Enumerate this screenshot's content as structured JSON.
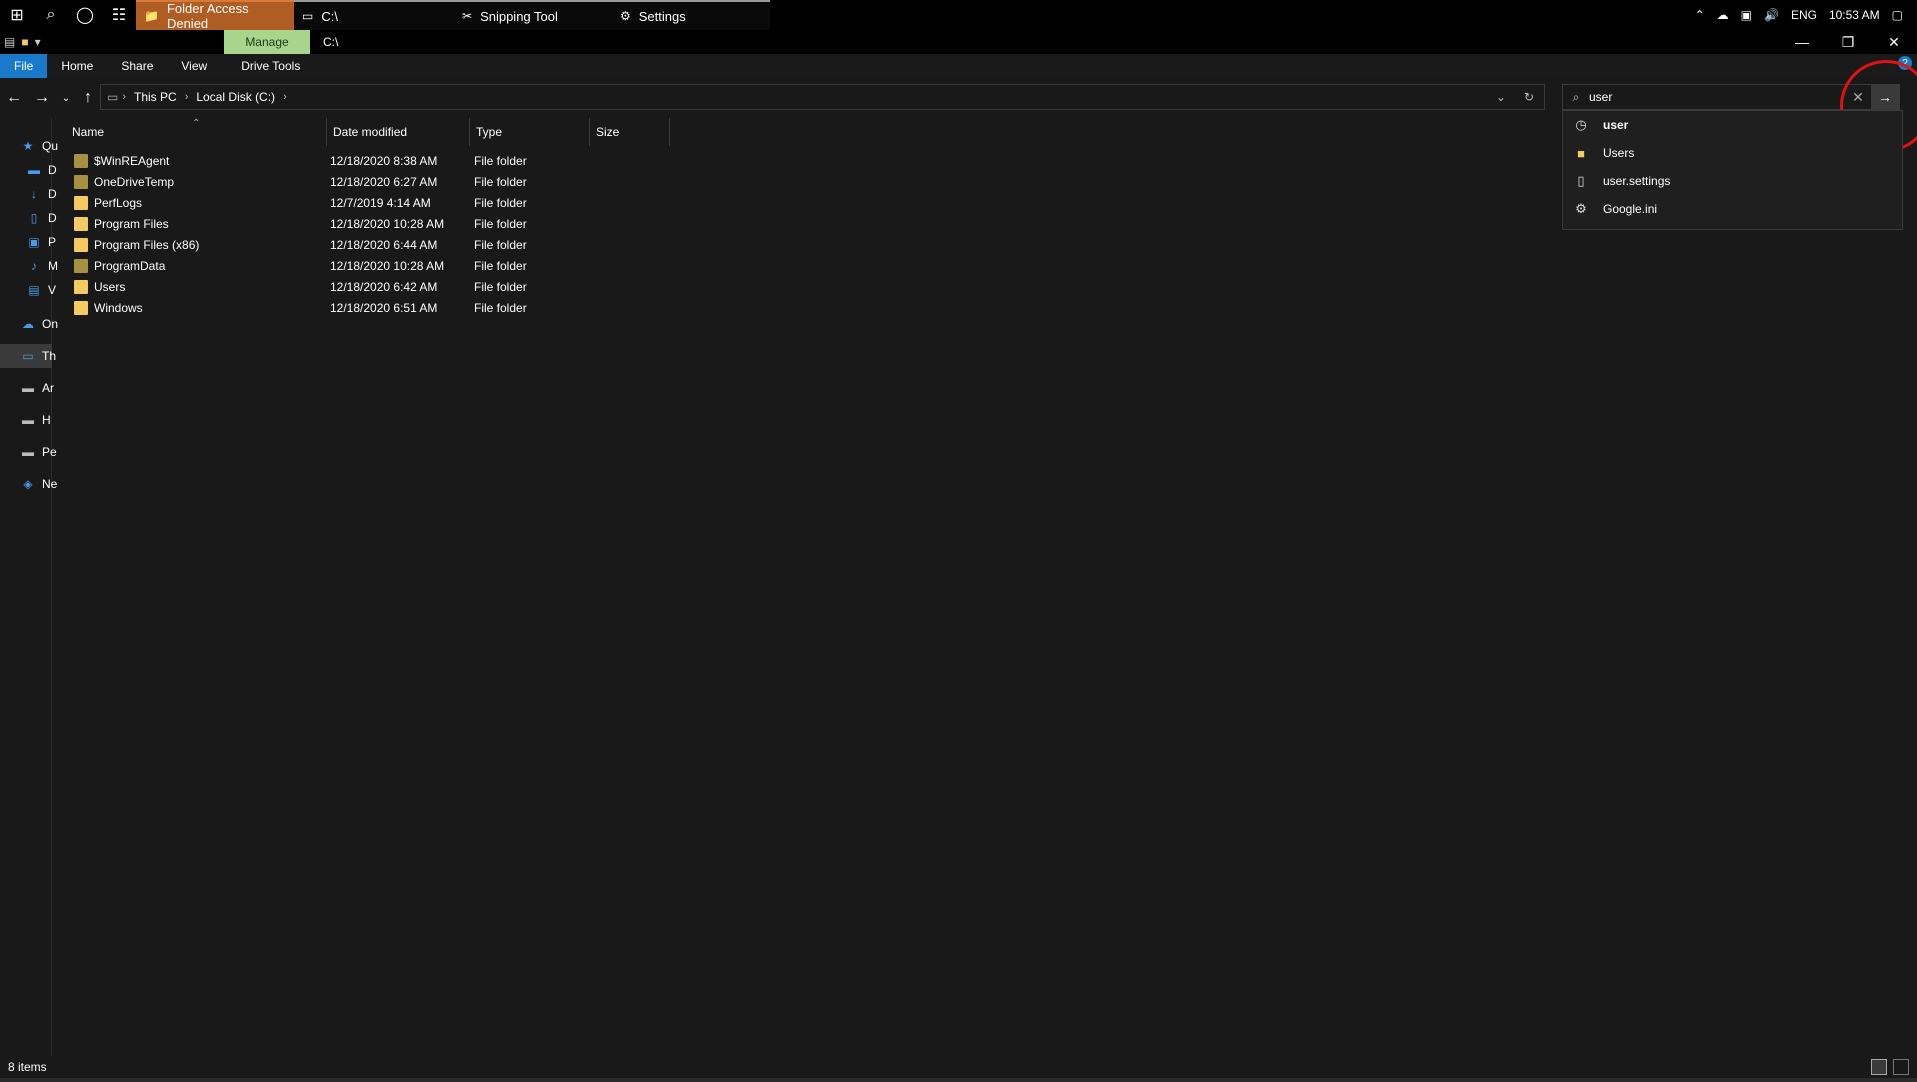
{
  "taskbar": {
    "tasks": [
      {
        "label": "Folder Access Denied",
        "icon": "explorer-icon"
      },
      {
        "label": "C:\\",
        "icon": "drive-icon"
      },
      {
        "label": "Snipping Tool",
        "icon": "snipping-icon"
      },
      {
        "label": "Settings",
        "icon": "gear-icon"
      }
    ],
    "tray": {
      "language": "ENG",
      "time": "10:53 AM"
    }
  },
  "window": {
    "manage_tab": "Manage",
    "title": "C:\\"
  },
  "ribbon": {
    "tabs": [
      "File",
      "Home",
      "Share",
      "View",
      "Drive Tools"
    ]
  },
  "address": {
    "crumbs": [
      "This PC",
      "Local Disk (C:)"
    ]
  },
  "search": {
    "value": "user",
    "suggestions": [
      {
        "label": "user",
        "icon": "history-icon"
      },
      {
        "label": "Users",
        "icon": "folder-icon"
      },
      {
        "label": "user.settings",
        "icon": "file-icon"
      },
      {
        "label": "Google.ini",
        "icon": "ini-file-icon"
      }
    ]
  },
  "navpane": {
    "items": [
      "Qu",
      "D",
      "D",
      "D",
      "P",
      "M",
      "V",
      "On",
      "Th",
      "Ar",
      "H",
      "Pe",
      "Ne"
    ]
  },
  "columns": {
    "name": "Name",
    "date": "Date modified",
    "type": "Type",
    "size": "Size"
  },
  "files": [
    {
      "name": "$WinREAgent",
      "date": "12/18/2020 8:38 AM",
      "type": "File folder",
      "dim": true
    },
    {
      "name": "OneDriveTemp",
      "date": "12/18/2020 6:27 AM",
      "type": "File folder",
      "dim": true
    },
    {
      "name": "PerfLogs",
      "date": "12/7/2019 4:14 AM",
      "type": "File folder",
      "dim": false
    },
    {
      "name": "Program Files",
      "date": "12/18/2020 10:28 AM",
      "type": "File folder",
      "dim": false
    },
    {
      "name": "Program Files (x86)",
      "date": "12/18/2020 6:44 AM",
      "type": "File folder",
      "dim": false
    },
    {
      "name": "ProgramData",
      "date": "12/18/2020 10:28 AM",
      "type": "File folder",
      "dim": true
    },
    {
      "name": "Users",
      "date": "12/18/2020 6:42 AM",
      "type": "File folder",
      "dim": false
    },
    {
      "name": "Windows",
      "date": "12/18/2020 6:51 AM",
      "type": "File folder",
      "dim": false
    }
  ],
  "status": {
    "items": "8 items"
  }
}
